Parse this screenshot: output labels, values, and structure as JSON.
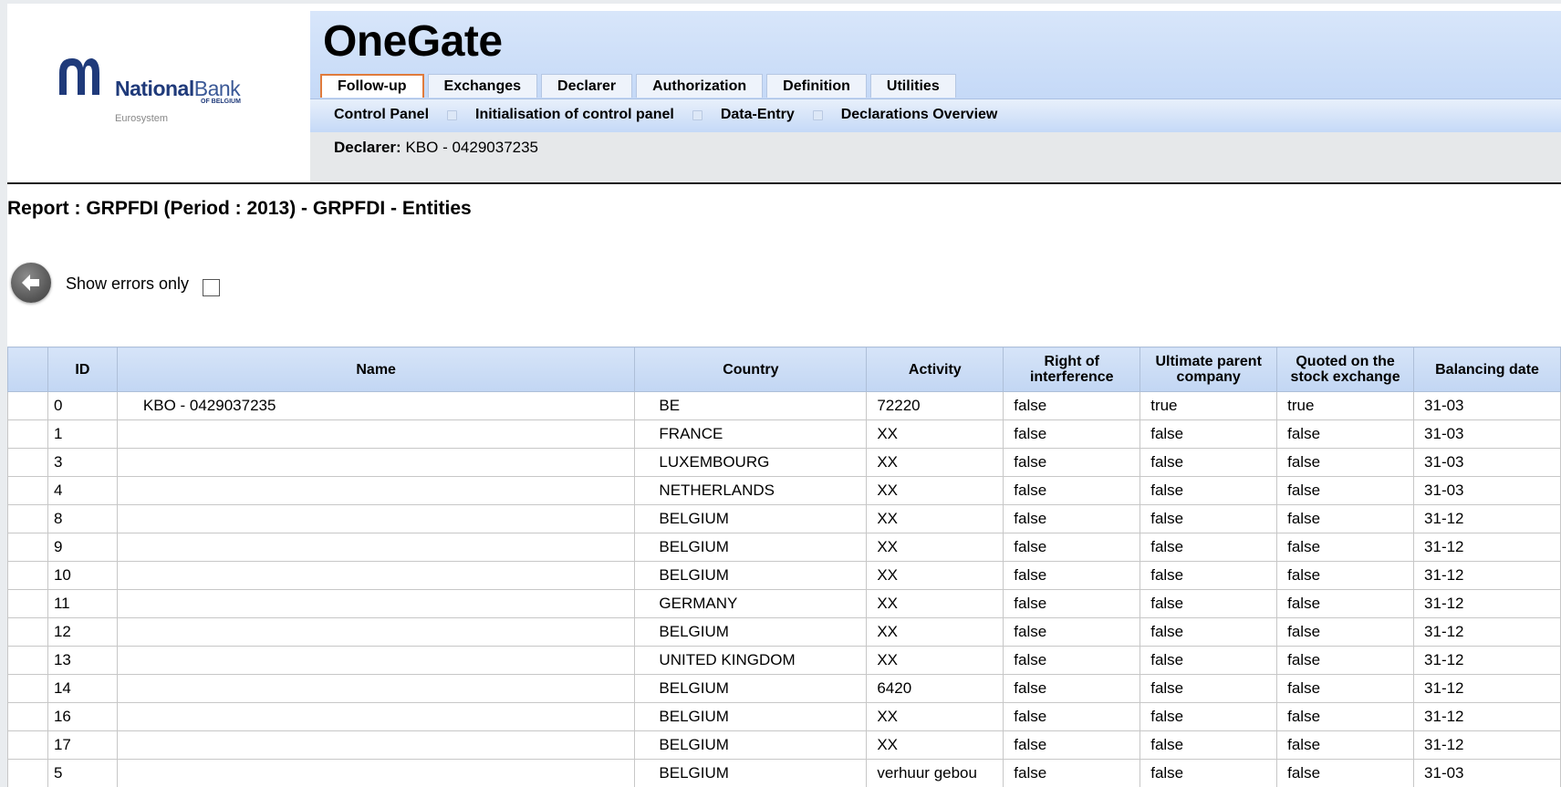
{
  "logo": {
    "name_bold": "National",
    "name_light": "Bank",
    "sub": "OF BELGIUM",
    "tagline": "Eurosystem"
  },
  "app": {
    "title": "OneGate"
  },
  "tabs": [
    {
      "label": "Follow-up",
      "active": true
    },
    {
      "label": "Exchanges",
      "active": false
    },
    {
      "label": "Declarer",
      "active": false
    },
    {
      "label": "Authorization",
      "active": false
    },
    {
      "label": "Definition",
      "active": false
    },
    {
      "label": "Utilities",
      "active": false
    }
  ],
  "submenu": [
    {
      "label": "Control Panel"
    },
    {
      "label": "Initialisation of control panel"
    },
    {
      "label": "Data-Entry"
    },
    {
      "label": "Declarations Overview"
    }
  ],
  "declarer": {
    "label": "Declarer:",
    "value": "KBO - 0429037235"
  },
  "report": {
    "title": "Report : GRPFDI (Period : 2013) - GRPFDI - Entities"
  },
  "filter": {
    "show_errors_label": "Show errors only",
    "show_errors_checked": false
  },
  "table": {
    "columns": [
      {
        "key": "sel",
        "label": ""
      },
      {
        "key": "id",
        "label": "ID"
      },
      {
        "key": "name",
        "label": "Name"
      },
      {
        "key": "country",
        "label": "Country"
      },
      {
        "key": "activity",
        "label": "Activity"
      },
      {
        "key": "right",
        "label_lines": [
          "Right of",
          "interference"
        ]
      },
      {
        "key": "ultimate",
        "label_lines": [
          "Ultimate parent",
          "company"
        ]
      },
      {
        "key": "quoted",
        "label_lines": [
          "Quoted on the",
          "stock exchange"
        ]
      },
      {
        "key": "balancing",
        "label": "Balancing date"
      }
    ],
    "rows": [
      {
        "id": "0",
        "name": "KBO - 0429037235",
        "country": "BE",
        "activity": "72220",
        "right": "false",
        "ultimate": "true",
        "quoted": "true",
        "balancing": "31-03"
      },
      {
        "id": "1",
        "name": "",
        "country": "FRANCE",
        "activity": "XX",
        "right": "false",
        "ultimate": "false",
        "quoted": "false",
        "balancing": "31-03"
      },
      {
        "id": "3",
        "name": "",
        "country": "LUXEMBOURG",
        "activity": "XX",
        "right": "false",
        "ultimate": "false",
        "quoted": "false",
        "balancing": "31-03"
      },
      {
        "id": "4",
        "name": "",
        "country": "NETHERLANDS",
        "activity": "XX",
        "right": "false",
        "ultimate": "false",
        "quoted": "false",
        "balancing": "31-03"
      },
      {
        "id": "8",
        "name": "",
        "country": "BELGIUM",
        "activity": "XX",
        "right": "false",
        "ultimate": "false",
        "quoted": "false",
        "balancing": "31-12"
      },
      {
        "id": "9",
        "name": "",
        "country": "BELGIUM",
        "activity": "XX",
        "right": "false",
        "ultimate": "false",
        "quoted": "false",
        "balancing": "31-12"
      },
      {
        "id": "10",
        "name": "",
        "country": "BELGIUM",
        "activity": "XX",
        "right": "false",
        "ultimate": "false",
        "quoted": "false",
        "balancing": "31-12"
      },
      {
        "id": "11",
        "name": "",
        "country": "GERMANY",
        "activity": "XX",
        "right": "false",
        "ultimate": "false",
        "quoted": "false",
        "balancing": "31-12"
      },
      {
        "id": "12",
        "name": "",
        "country": "BELGIUM",
        "activity": "XX",
        "right": "false",
        "ultimate": "false",
        "quoted": "false",
        "balancing": "31-12"
      },
      {
        "id": "13",
        "name": "",
        "country": "UNITED KINGDOM",
        "activity": "XX",
        "right": "false",
        "ultimate": "false",
        "quoted": "false",
        "balancing": "31-12"
      },
      {
        "id": "14",
        "name": "",
        "country": "BELGIUM",
        "activity": "6420",
        "right": "false",
        "ultimate": "false",
        "quoted": "false",
        "balancing": "31-12"
      },
      {
        "id": "16",
        "name": "",
        "country": "BELGIUM",
        "activity": "XX",
        "right": "false",
        "ultimate": "false",
        "quoted": "false",
        "balancing": "31-12"
      },
      {
        "id": "17",
        "name": "",
        "country": "BELGIUM",
        "activity": "XX",
        "right": "false",
        "ultimate": "false",
        "quoted": "false",
        "balancing": "31-12"
      },
      {
        "id": "5",
        "name": "",
        "country": "BELGIUM",
        "activity": "verhuur gebou",
        "right": "false",
        "ultimate": "false",
        "quoted": "false",
        "balancing": "31-03"
      }
    ]
  },
  "colors": {
    "header_band": "#c5d9f7",
    "active_tab_border": "#e07b3c",
    "logo_blue": "#1f3a7a"
  },
  "icons": {
    "back": "arrow-left-icon",
    "logo": "nbb-logo-icon"
  }
}
